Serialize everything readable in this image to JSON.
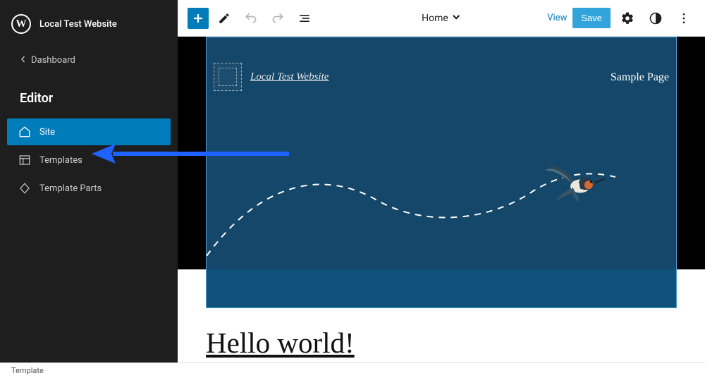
{
  "sidebar": {
    "site_title": "Local Test Website",
    "back_label": "Dashboard",
    "heading": "Editor",
    "items": [
      {
        "label": "Site",
        "icon": "home-icon",
        "active": true
      },
      {
        "label": "Templates",
        "icon": "layout-icon",
        "active": false
      },
      {
        "label": "Template Parts",
        "icon": "diamond-icon",
        "active": false
      }
    ]
  },
  "topbar": {
    "template_label": "Home",
    "view_label": "View",
    "save_label": "Save"
  },
  "hero": {
    "site_title": "Local Test Website",
    "nav_item": "Sample Page"
  },
  "article": {
    "title": "Hello world!"
  },
  "footer": {
    "label": "Template"
  },
  "colors": {
    "accent": "#007cba",
    "hero_bg": "#15476a",
    "arrow": "#1E62FF"
  }
}
